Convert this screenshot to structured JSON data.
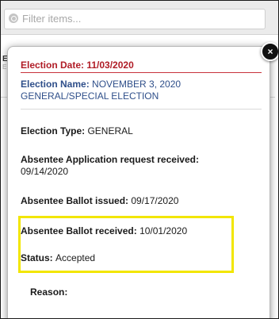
{
  "filter": {
    "placeholder": "Filter items..."
  },
  "background_item": {
    "letter": "E",
    "letter_small": "E"
  },
  "popover": {
    "close_label": "×",
    "election_date_label": "Election Date: ",
    "election_date_value": "11/03/2020",
    "election_name_label": "Election Name: ",
    "election_name_value": "NOVEMBER 3, 2020 GENERAL/SPECIAL ELECTION",
    "election_type_label": "Election Type: ",
    "election_type_value": "GENERAL",
    "application_label": "Absentee Application request received:",
    "application_value": "09/14/2020",
    "issued_label": "Absentee Ballot issued: ",
    "issued_value": "09/17/2020",
    "received_label": "Absentee Ballot received: ",
    "received_value": "10/01/2020",
    "status_label": "Status: ",
    "status_value": "Accepted",
    "reason_label": "Reason:"
  },
  "colors": {
    "highlight": "#f2e600",
    "date_red": "#b01c26",
    "name_blue": "#2f4f8a"
  }
}
